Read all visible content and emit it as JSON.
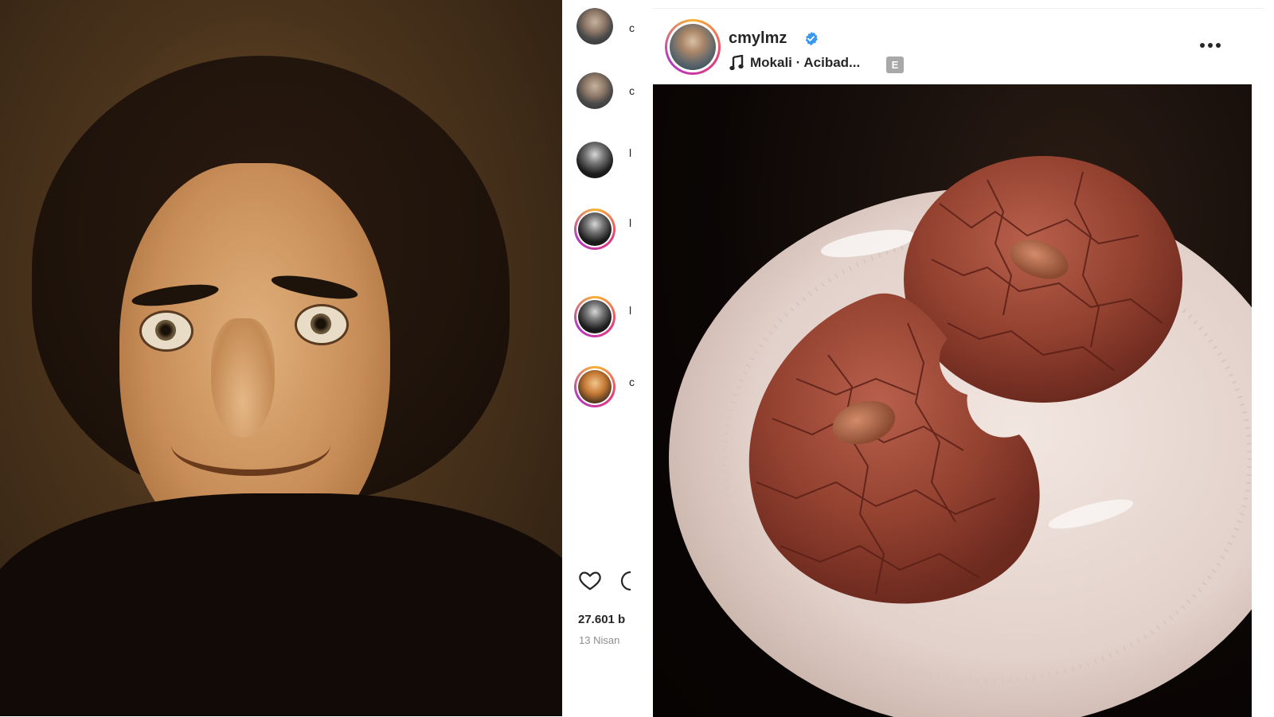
{
  "post": {
    "username": "cmylmz",
    "music": "Mokali · Acibad...",
    "explicit_badge": "E",
    "more_label": "•••"
  },
  "side": {
    "likes": "27.601 b",
    "date": "13 Nisan"
  },
  "icons": {
    "music": "music-note-icon",
    "verified": "verified-badge-icon",
    "like": "heart-icon",
    "comment": "comment-icon",
    "more": "more-options-icon"
  },
  "colors": {
    "verified": "#3897f0",
    "story_ring": "#e33b7c",
    "text": "#262626",
    "muted": "#8e8e8e"
  }
}
